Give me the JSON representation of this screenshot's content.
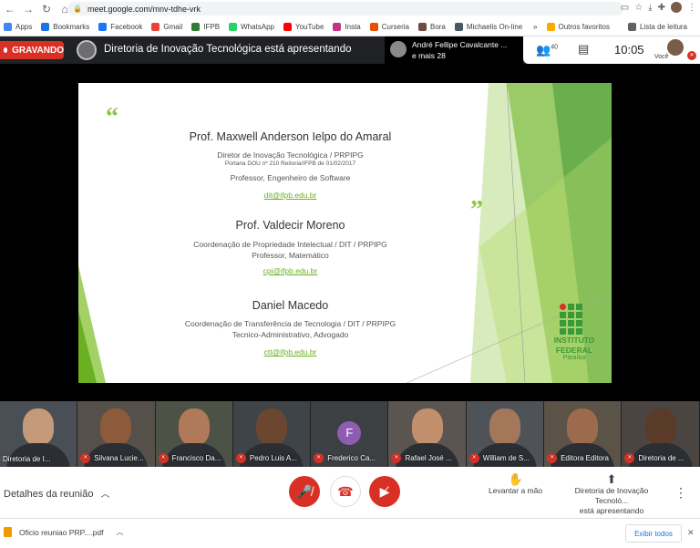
{
  "browser": {
    "url": "meet.google.com/mnv-tdhe-vrk",
    "bookmarks": [
      {
        "label": "Apps",
        "color": "#4285f4"
      },
      {
        "label": "Bookmarks",
        "color": "#1a73e8"
      },
      {
        "label": "Facebook",
        "color": "#1877f2"
      },
      {
        "label": "Gmail",
        "color": "#ea4335"
      },
      {
        "label": "IFPB",
        "color": "#2e7d32"
      },
      {
        "label": "WhatsApp",
        "color": "#25d366"
      },
      {
        "label": "YouTube",
        "color": "#ff0000"
      },
      {
        "label": "Insta",
        "color": "#c13584"
      },
      {
        "label": "Curseria",
        "color": "#e65100"
      },
      {
        "label": "Bora",
        "color": "#6d4c41"
      },
      {
        "label": "Michaelis On-line",
        "color": "#455a64"
      }
    ],
    "other_favorites": "Outros favoritos",
    "reading_list": "Lista de leitura"
  },
  "meet": {
    "recording_label": "GRAVANDO",
    "presenting_title": "Diretoria de Inovação Tecnológica está apresentando",
    "pip_name": "André Fellipe Cavalcante ...",
    "pip_more": "e mais 28",
    "participants_count": "40",
    "clock": "10:05",
    "you_label": "Você"
  },
  "slide": {
    "quote_open": "“",
    "quote_close": "”",
    "p1_name": "Prof. Maxwell Anderson Ielpo do Amaral",
    "p1_role": "Diretor de Inovação Tecnológica / PRPIPG",
    "p1_ordinance": "Portaria DOU nº 210 Reitoria/IFPB de 01/02/2017",
    "p1_title": "Professor, Engenheiro de Software",
    "p1_email": "dit@ifpb.edu.br",
    "p2_name": "Prof. Valdecir Moreno",
    "p2_role": "Coordenação de Propriedade Intelectual / DIT / PRPIPG",
    "p2_title": "Professor, Matemático",
    "p2_email": "cpi@ifpb.edu.br",
    "p3_name": "Daniel Macedo",
    "p3_role": "Coordenação de Transferência de Tecnologia / DIT / PRPIPG",
    "p3_title": "Tecnico-Administrativo, Advogado",
    "p3_email": "ctt@ifpb.edu.br",
    "logo_line1": "INSTITUTO",
    "logo_line2": "FEDERAL",
    "logo_line3": "Paraíba"
  },
  "participants": [
    {
      "name": "Diretoria de I...",
      "muted": false
    },
    {
      "name": "Silvana Lucie...",
      "muted": true
    },
    {
      "name": "Francisco Da...",
      "muted": true
    },
    {
      "name": "Pedro Luis A...",
      "muted": true
    },
    {
      "name": "Frederico Ca...",
      "muted": true,
      "initial": "F"
    },
    {
      "name": "Rafael José ...",
      "muted": true
    },
    {
      "name": "William de S...",
      "muted": true
    },
    {
      "name": "Editora Editora",
      "muted": true
    },
    {
      "name": "Diretoria de ...",
      "muted": true
    }
  ],
  "controls": {
    "details": "Detalhes da reunião",
    "raise_hand": "Levantar a mão",
    "presenting_line1": "Diretoria de Inovação Tecnoló...",
    "presenting_line2": "está apresentando"
  },
  "downloads": {
    "file": "Oficio reuniao PRP....pdf",
    "show_all": "Exibir todos"
  }
}
